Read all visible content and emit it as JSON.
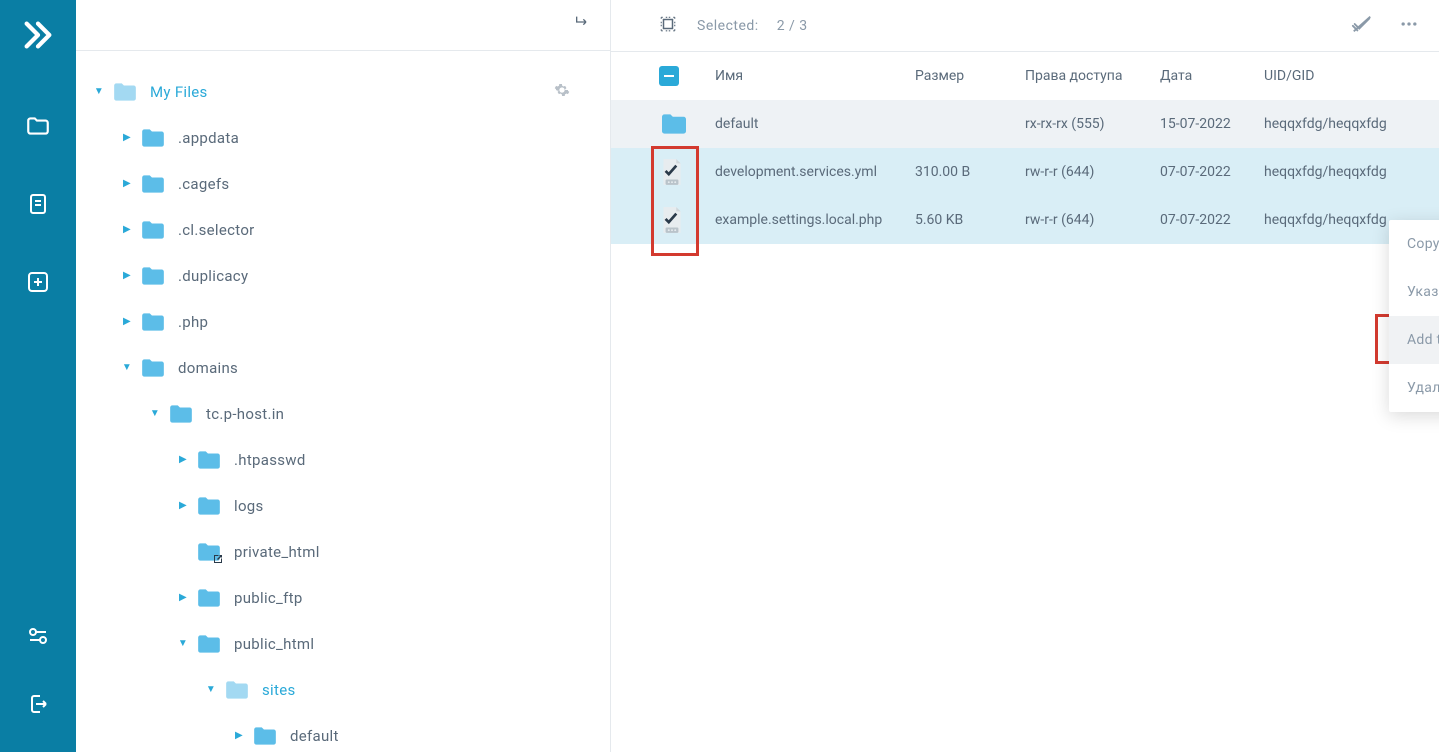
{
  "toolbar": {
    "selected_label": "Selected:",
    "selected_count": "2 / 3"
  },
  "sidebar": {
    "root": {
      "label": "My Files"
    },
    "items": [
      {
        "label": ".appdata",
        "level": 1,
        "toggle": "closed"
      },
      {
        "label": ".cagefs",
        "level": 1,
        "toggle": "closed"
      },
      {
        "label": ".cl.selector",
        "level": 1,
        "toggle": "closed"
      },
      {
        "label": ".duplicacy",
        "level": 1,
        "toggle": "closed"
      },
      {
        "label": ".php",
        "level": 1,
        "toggle": "closed"
      },
      {
        "label": "domains",
        "level": 1,
        "toggle": "open"
      },
      {
        "label": "tc.p-host.in",
        "level": 2,
        "toggle": "open"
      },
      {
        "label": ".htpasswd",
        "level": 3,
        "toggle": "closed"
      },
      {
        "label": "logs",
        "level": 3,
        "toggle": "closed"
      },
      {
        "label": "private_html",
        "level": 3,
        "toggle": "none",
        "link": true
      },
      {
        "label": "public_ftp",
        "level": 3,
        "toggle": "closed"
      },
      {
        "label": "public_html",
        "level": 3,
        "toggle": "open"
      },
      {
        "label": "sites",
        "level": 4,
        "toggle": "open",
        "active": true
      },
      {
        "label": "default",
        "level": 5,
        "toggle": "closed"
      }
    ]
  },
  "table": {
    "headers": {
      "name": "Имя",
      "size": "Размер",
      "perm": "Права доступа",
      "date": "Дата",
      "uid": "UID/GID"
    },
    "rows": [
      {
        "type": "folder",
        "selected": false,
        "name": "default",
        "size": "",
        "perm": "rx-rx-rx (555)",
        "date": "15-07-2022",
        "uid": "heqqxfdg/heqqxfdg"
      },
      {
        "type": "file",
        "selected": true,
        "name": "development.services.yml",
        "size": "310.00 B",
        "perm": "rw-r-r (644)",
        "date": "07-07-2022",
        "uid": "heqqxfdg/heqqxfdg"
      },
      {
        "type": "file",
        "selected": true,
        "name": "example.settings.local.php",
        "size": "5.60 KB",
        "perm": "rw-r-r (644)",
        "date": "07-07-2022",
        "uid": "heqqxfdg/heqqxfdg"
      }
    ]
  },
  "context_menu": {
    "items": [
      {
        "label": "Copy/Move to..."
      },
      {
        "label": "Указать права доступа"
      },
      {
        "label": "Add to archive",
        "hover": true
      },
      {
        "label": "Удалить"
      }
    ]
  }
}
